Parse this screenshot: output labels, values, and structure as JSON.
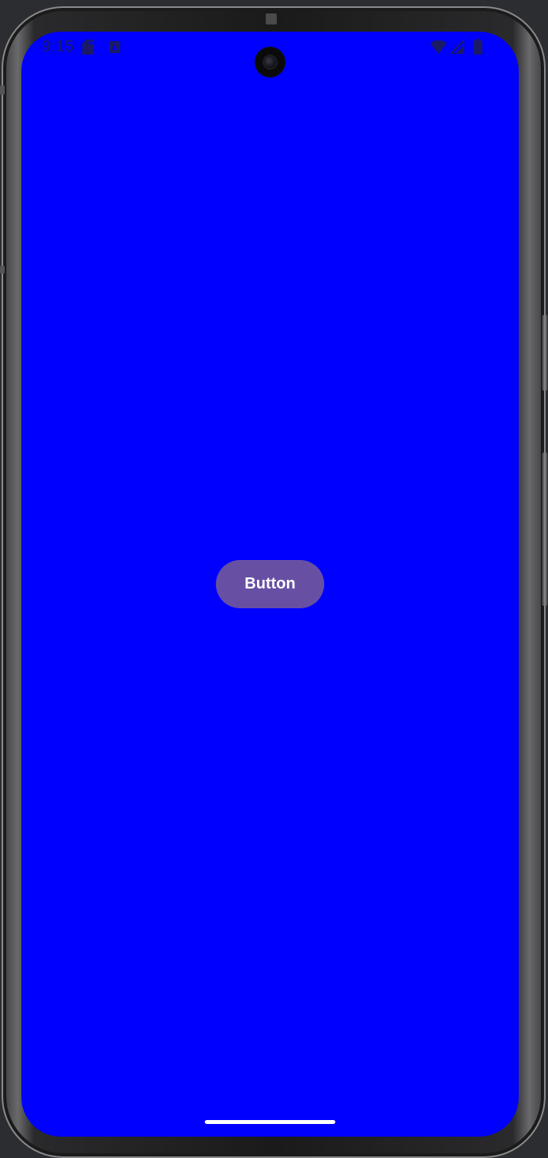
{
  "status_bar": {
    "time": "9:15",
    "left_icons": [
      "sd-card-icon",
      "notification-icon"
    ],
    "right_icons": [
      "wifi-icon",
      "signal-icon",
      "battery-icon"
    ]
  },
  "colors": {
    "screen_background": "#0000ff",
    "button_background": "#6750a4",
    "button_text": "#ffffff",
    "status_icons": "#1a1a66"
  },
  "main": {
    "button_label": "Button"
  }
}
